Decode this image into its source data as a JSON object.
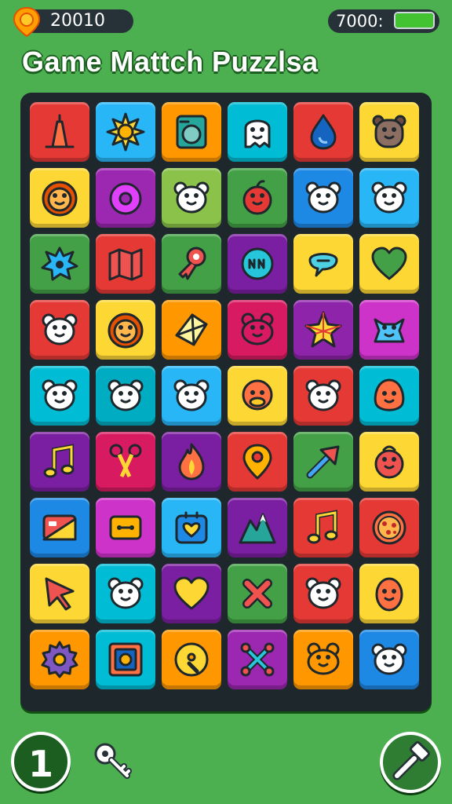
{
  "header": {
    "coins": "20010",
    "energy_label": "7000:",
    "energy_level": 1.0,
    "title": "Game Mattch Puzzlsa"
  },
  "board": {
    "rows": [
      [
        {
          "color": "#e53935",
          "icon": "lamp-icon"
        },
        {
          "color": "#29b6f6",
          "icon": "sun-icon"
        },
        {
          "color": "#ff9800",
          "icon": "washing-machine-icon"
        },
        {
          "color": "#00bcd4",
          "icon": "ghost-face-icon"
        },
        {
          "color": "#e53935",
          "icon": "water-drop-icon"
        },
        {
          "color": "#fdd835",
          "icon": "bear-icon"
        }
      ],
      [
        {
          "color": "#fdd835",
          "icon": "lion-face-icon"
        },
        {
          "color": "#9c27b0",
          "icon": "donut-icon"
        },
        {
          "color": "#8bc34a",
          "icon": "bear-face-icon"
        },
        {
          "color": "#43a047",
          "icon": "apple-face-icon"
        },
        {
          "color": "#1e88e5",
          "icon": "bear-face-icon"
        },
        {
          "color": "#29b6f6",
          "icon": "bear-face-icon"
        }
      ],
      [
        {
          "color": "#43a047",
          "icon": "splash-icon"
        },
        {
          "color": "#e53935",
          "icon": "map-icon"
        },
        {
          "color": "#43a047",
          "icon": "ribbon-icon"
        },
        {
          "color": "#7b1fa2",
          "icon": "emblem-icon"
        },
        {
          "color": "#fdd835",
          "icon": "speech-bubble-icon"
        },
        {
          "color": "#fdd835",
          "icon": "heart-icon"
        }
      ],
      [
        {
          "color": "#e53935",
          "icon": "bear-face-icon"
        },
        {
          "color": "#fdd835",
          "icon": "lion-face-icon"
        },
        {
          "color": "#ff9800",
          "icon": "crystal-icon"
        },
        {
          "color": "#d81b60",
          "icon": "frog-face-icon"
        },
        {
          "color": "#8e24aa",
          "icon": "star-gem-icon"
        },
        {
          "color": "#ce33c9",
          "icon": "cat-face-icon"
        }
      ],
      [
        {
          "color": "#00bcd4",
          "icon": "bear-face-icon"
        },
        {
          "color": "#00acc1",
          "icon": "bear-face-icon"
        },
        {
          "color": "#29b6f6",
          "icon": "bear-face-icon"
        },
        {
          "color": "#fdd835",
          "icon": "duck-face-icon"
        },
        {
          "color": "#e53935",
          "icon": "bear-face-icon"
        },
        {
          "color": "#00bcd4",
          "icon": "blob-face-icon"
        }
      ],
      [
        {
          "color": "#7b1fa2",
          "icon": "music-note-icon"
        },
        {
          "color": "#d81b60",
          "icon": "scissors-icon"
        },
        {
          "color": "#7b1fa2",
          "icon": "flame-icon"
        },
        {
          "color": "#e53935",
          "icon": "location-pin-icon"
        },
        {
          "color": "#43a047",
          "icon": "arrow-icon"
        },
        {
          "color": "#fdd835",
          "icon": "bag-face-icon"
        }
      ],
      [
        {
          "color": "#1e88e5",
          "icon": "card-icon"
        },
        {
          "color": "#ce33c9",
          "icon": "cassette-icon"
        },
        {
          "color": "#29b6f6",
          "icon": "heart-box-icon"
        },
        {
          "color": "#7b1fa2",
          "icon": "mountain-icon"
        },
        {
          "color": "#e53935",
          "icon": "music-note-icon"
        },
        {
          "color": "#e53935",
          "icon": "pizza-icon"
        }
      ],
      [
        {
          "color": "#fdd835",
          "icon": "cursor-icon"
        },
        {
          "color": "#00bcd4",
          "icon": "bear-face-icon"
        },
        {
          "color": "#7b1fa2",
          "icon": "heart-icon"
        },
        {
          "color": "#43a047",
          "icon": "cross-icon"
        },
        {
          "color": "#e53935",
          "icon": "bear-face-icon"
        },
        {
          "color": "#fdd835",
          "icon": "egg-face-icon"
        }
      ],
      [
        {
          "color": "#ff9800",
          "icon": "gear-icon"
        },
        {
          "color": "#00bcd4",
          "icon": "photo-frame-icon"
        },
        {
          "color": "#ff9800",
          "icon": "disc-icon"
        },
        {
          "color": "#9c27b0",
          "icon": "crossed-bones-icon"
        },
        {
          "color": "#ff9800",
          "icon": "frog-face-icon"
        },
        {
          "color": "#1e88e5",
          "icon": "bear-face-icon"
        }
      ]
    ]
  },
  "footer": {
    "level": "1",
    "key_icon": "key-icon",
    "tool_icon": "hammer-icon"
  }
}
